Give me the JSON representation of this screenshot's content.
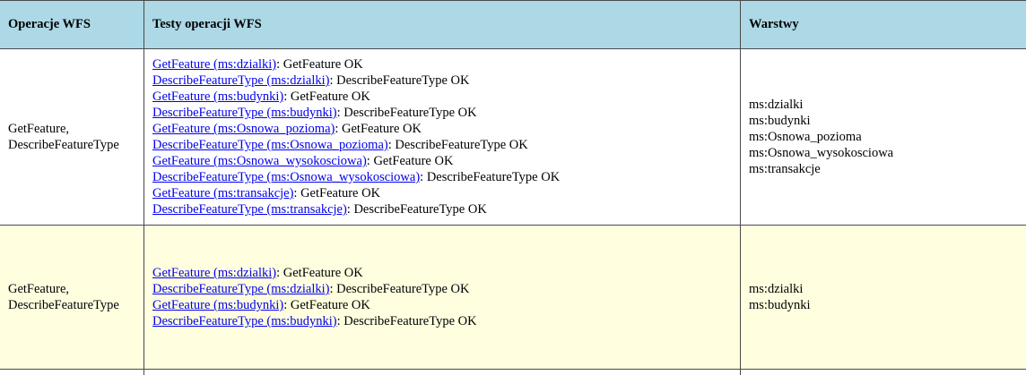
{
  "headers": {
    "operations": "Operacje WFS",
    "tests": "Testy operacji WFS",
    "layers": "Warstwy"
  },
  "rows": [
    {
      "operations": [
        "GetFeature,",
        "DescribeFeatureType"
      ],
      "tests": [
        {
          "link": "GetFeature (ms:dzialki)",
          "result": ": GetFeature OK"
        },
        {
          "link": "DescribeFeatureType (ms:dzialki)",
          "result": ": DescribeFeatureType OK"
        },
        {
          "link": "GetFeature (ms:budynki)",
          "result": ": GetFeature OK"
        },
        {
          "link": "DescribeFeatureType (ms:budynki)",
          "result": ": DescribeFeatureType OK"
        },
        {
          "link": "GetFeature (ms:Osnowa_pozioma)",
          "result": ": GetFeature OK"
        },
        {
          "link": "DescribeFeatureType (ms:Osnowa_pozioma)",
          "result": ": DescribeFeatureType OK"
        },
        {
          "link": "GetFeature (ms:Osnowa_wysokosciowa)",
          "result": ": GetFeature OK"
        },
        {
          "link": "DescribeFeatureType (ms:Osnowa_wysokosciowa)",
          "result": ": DescribeFeatureType OK"
        },
        {
          "link": "GetFeature (ms:transakcje)",
          "result": ": GetFeature OK"
        },
        {
          "link": "DescribeFeatureType (ms:transakcje)",
          "result": ": DescribeFeatureType OK"
        }
      ],
      "layers": [
        "ms:dzialki",
        "ms:budynki",
        "ms:Osnowa_pozioma",
        "ms:Osnowa_wysokosciowa",
        "ms:transakcje"
      ]
    },
    {
      "operations": [
        "GetFeature,",
        "DescribeFeatureType"
      ],
      "tests": [
        {
          "link": "GetFeature (ms:dzialki)",
          "result": ": GetFeature OK"
        },
        {
          "link": "DescribeFeatureType (ms:dzialki)",
          "result": ": DescribeFeatureType OK"
        },
        {
          "link": "GetFeature (ms:budynki)",
          "result": ": GetFeature OK"
        },
        {
          "link": "DescribeFeatureType (ms:budynki)",
          "result": ": DescribeFeatureType OK"
        }
      ],
      "layers": [
        "ms:dzialki",
        "ms:budynki"
      ]
    }
  ]
}
